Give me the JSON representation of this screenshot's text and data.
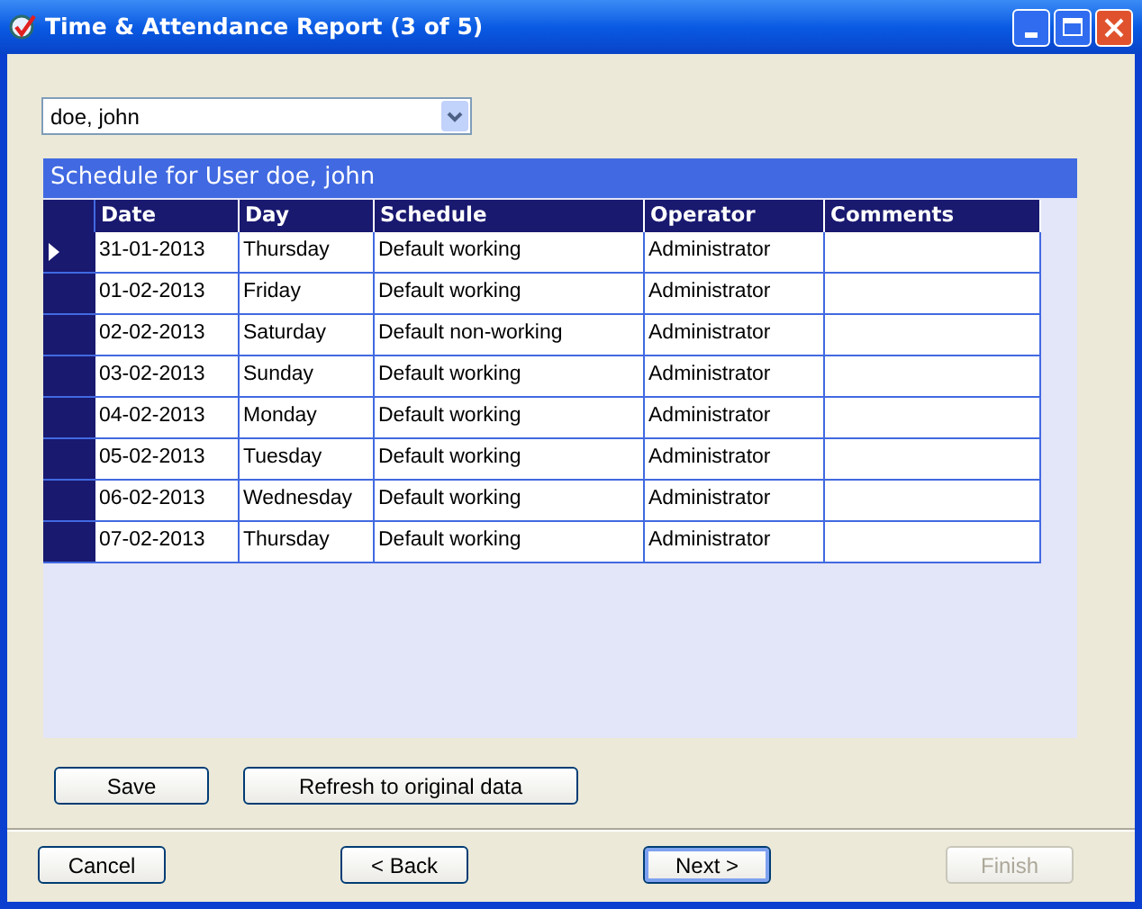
{
  "window": {
    "title": "Time & Attendance Report (3 of 5)"
  },
  "user_select": {
    "value": "doe, john"
  },
  "schedule": {
    "title": "Schedule for User doe, john",
    "columns": [
      "Date",
      "Day",
      "Schedule",
      "Operator",
      "Comments"
    ],
    "rows": [
      {
        "selected": true,
        "cells": [
          "31-01-2013",
          "Thursday",
          "Default working",
          "Administrator",
          ""
        ]
      },
      {
        "selected": false,
        "cells": [
          "01-02-2013",
          "Friday",
          "Default working",
          "Administrator",
          ""
        ]
      },
      {
        "selected": false,
        "cells": [
          "02-02-2013",
          "Saturday",
          "Default non-working",
          "Administrator",
          ""
        ]
      },
      {
        "selected": false,
        "cells": [
          "03-02-2013",
          "Sunday",
          "Default working",
          "Administrator",
          ""
        ]
      },
      {
        "selected": false,
        "cells": [
          "04-02-2013",
          "Monday",
          "Default working",
          "Administrator",
          ""
        ]
      },
      {
        "selected": false,
        "cells": [
          "05-02-2013",
          "Tuesday",
          "Default working",
          "Administrator",
          ""
        ]
      },
      {
        "selected": false,
        "cells": [
          "06-02-2013",
          "Wednesday",
          "Default working",
          "Administrator",
          ""
        ]
      },
      {
        "selected": false,
        "cells": [
          "07-02-2013",
          "Thursday",
          "Default working",
          "Administrator",
          ""
        ]
      }
    ]
  },
  "actions": [
    {
      "label": "Save"
    },
    {
      "label": "Refresh to original data"
    }
  ],
  "wizard_buttons": [
    {
      "label": "Cancel",
      "default": false,
      "disabled": false
    },
    {
      "label": "< Back",
      "default": false,
      "disabled": false
    },
    {
      "label": "Next >",
      "default": true,
      "disabled": false
    },
    {
      "label": "Finish",
      "default": false,
      "disabled": true
    }
  ]
}
